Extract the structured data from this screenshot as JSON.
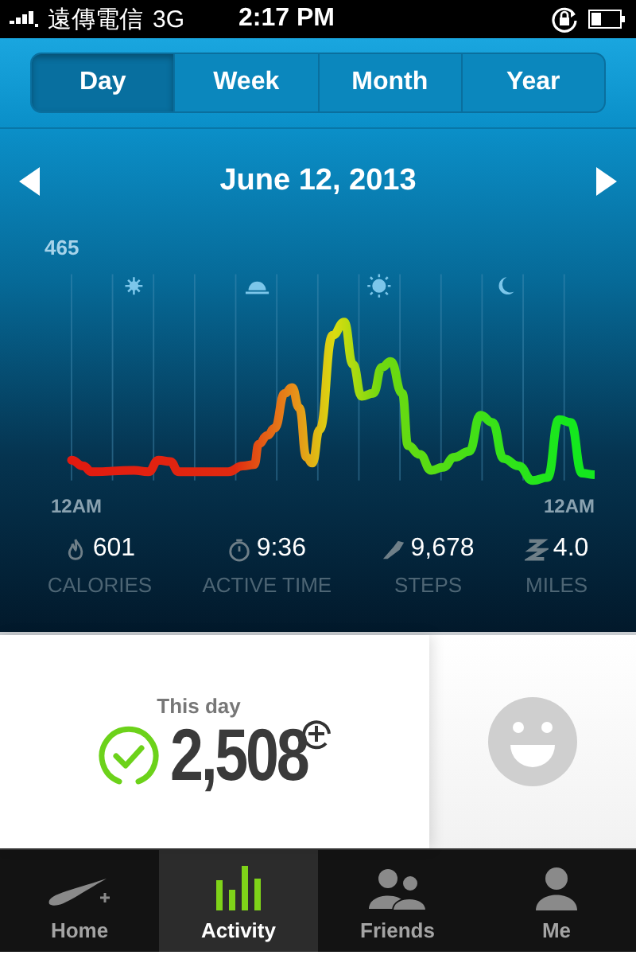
{
  "status_bar": {
    "carrier": "遠傳電信",
    "network": "3G",
    "time": "2:17 PM"
  },
  "tabs": [
    {
      "label": "Day",
      "selected": true
    },
    {
      "label": "Week",
      "selected": false
    },
    {
      "label": "Month",
      "selected": false
    },
    {
      "label": "Year",
      "selected": false
    }
  ],
  "date": "June 12, 2013",
  "graph": {
    "max_label": "465",
    "x_labels": [
      "12AM",
      "12AM"
    ]
  },
  "stats": [
    {
      "kind": "calories",
      "value": "601",
      "label": "CALORIES"
    },
    {
      "kind": "time",
      "value": "9:36",
      "label": "ACTIVE TIME"
    },
    {
      "kind": "steps",
      "value": "9,678",
      "label": "STEPS"
    },
    {
      "kind": "miles",
      "value": "4.0",
      "label": "MILES"
    }
  ],
  "summary": {
    "title": "This day",
    "value": "2,508",
    "goal_met": true
  },
  "nav": [
    {
      "kind": "home",
      "label": "Home",
      "selected": false
    },
    {
      "kind": "activity",
      "label": "Activity",
      "selected": true
    },
    {
      "kind": "friends",
      "label": "Friends",
      "selected": false
    },
    {
      "kind": "me",
      "label": "Me",
      "selected": false
    }
  ]
}
